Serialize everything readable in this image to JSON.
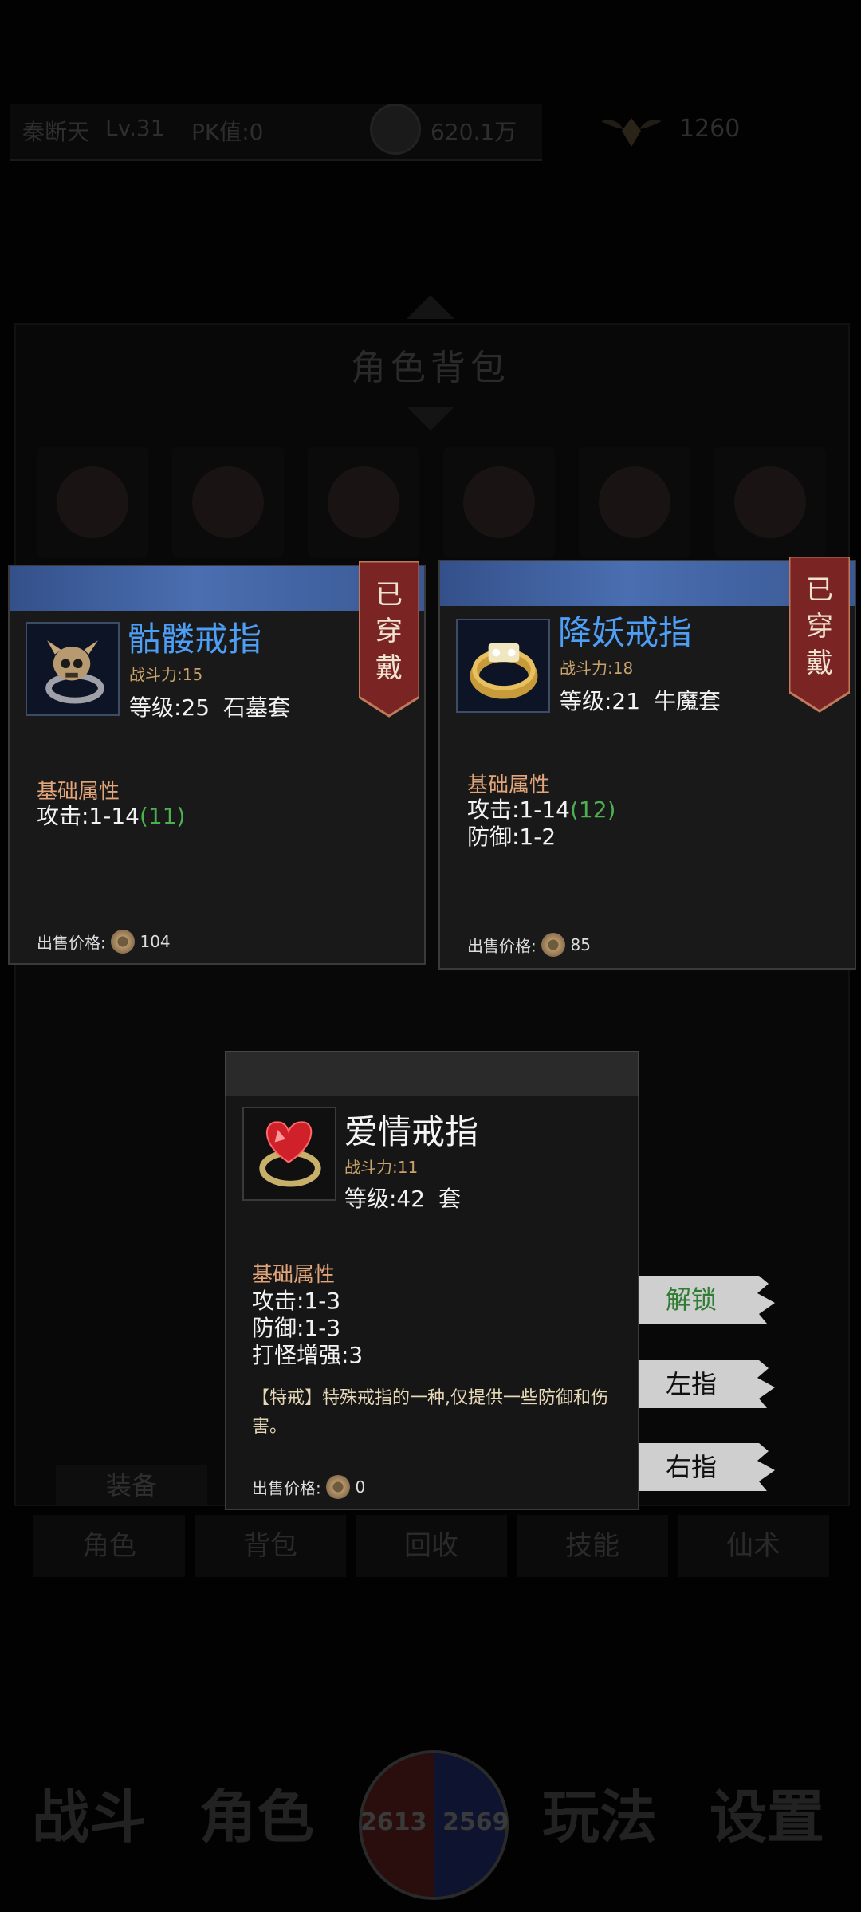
{
  "header": {
    "player_name": "秦断天",
    "level": "Lv.31",
    "pk": "PK值:0",
    "gold": "620.1万",
    "gem_count": "1260"
  },
  "bag": {
    "title": "角色背包"
  },
  "tabs": {
    "equip_label": "装备",
    "items": [
      "角色",
      "背包",
      "回收",
      "技能",
      "仙术"
    ]
  },
  "bottom_nav": {
    "left1": "战斗",
    "left2": "角色",
    "right1": "玩法",
    "right2": "设置",
    "hp": "2613",
    "mp": "2569"
  },
  "card_left": {
    "name": "骷髅戒指",
    "power": "战斗力:15",
    "level": "等级:25",
    "set": "石墓套",
    "base_label": "基础属性",
    "attack": "攻击:1-14",
    "attack_bonus": "(11)",
    "sell_label": "出售价格:",
    "sell_price": "104",
    "badge": [
      "已",
      "穿",
      "戴"
    ],
    "icon": "skull-ring-icon"
  },
  "card_right": {
    "name": "降妖戒指",
    "power": "战斗力:18",
    "level": "等级:21",
    "set": "牛魔套",
    "base_label": "基础属性",
    "attack": "攻击:1-14",
    "attack_bonus": "(12)",
    "defense": "防御:1-2",
    "sell_label": "出售价格:",
    "sell_price": "85",
    "badge": [
      "已",
      "穿",
      "戴"
    ],
    "icon": "gold-ring-icon"
  },
  "popup": {
    "name": "爱情戒指",
    "power": "战斗力:11",
    "level": "等级:42",
    "set": "套",
    "base_label": "基础属性",
    "attack": "攻击:1-3",
    "defense": "防御:1-3",
    "pve": "打怪增强:3",
    "desc_tag": "【特戒】",
    "desc": "特殊戒指的一种,仅提供一些防御和伤害。",
    "sell_label": "出售价格:",
    "sell_price": "0",
    "icon": "ruby-heart-ring-icon"
  },
  "actions": {
    "unlock": "解锁",
    "left_finger": "左指",
    "right_finger": "右指"
  },
  "colors": {
    "item_name": "#4d9ef5",
    "bonus": "#4caf50",
    "section": "#e2a57a",
    "badge": "#7a2424",
    "unlock_text": "#2e7d32"
  }
}
